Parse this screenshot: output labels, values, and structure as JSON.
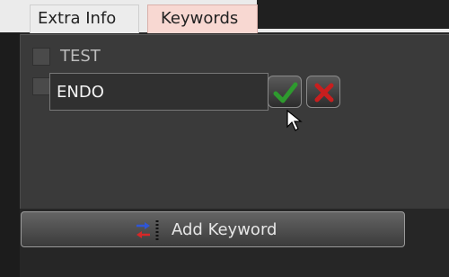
{
  "tabs": [
    {
      "label": "Extra Info"
    },
    {
      "label": "Keywords"
    }
  ],
  "keywords": [
    {
      "label": "TEST",
      "checked": false
    }
  ],
  "editor": {
    "value": "ENDO",
    "confirm_icon": "green-checkmark-icon",
    "cancel_icon": "red-x-icon"
  },
  "add_button": {
    "label": "Add Keyword",
    "icon": "add-keyword-icon"
  },
  "colors": {
    "confirm": "#2e9a2e",
    "cancel": "#c81e1e",
    "active_tab": "#f8d8d2"
  }
}
